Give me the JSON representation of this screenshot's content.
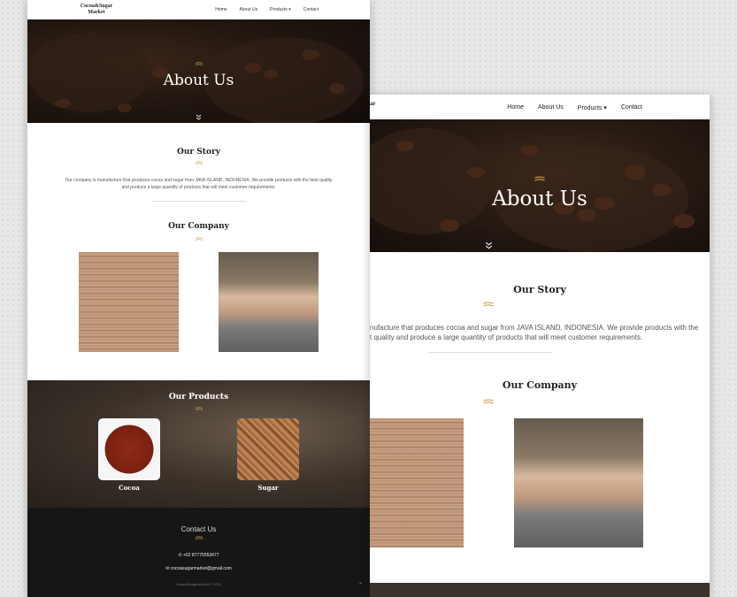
{
  "site": {
    "logo": "Cocoa&Sugar Market",
    "logo_partial": "ar",
    "nav": [
      {
        "label": "Home"
      },
      {
        "label": "About Us"
      },
      {
        "label": "Products ▾"
      },
      {
        "label": "Contact"
      }
    ]
  },
  "hero": {
    "title": "About Us"
  },
  "story": {
    "heading": "Our Story",
    "text": "Our company is manufacture that produces cocoa and sugar from JAVA ISLAND, INDONESIA. We provide products with the best quality and produce a large quantity of products that will meet customer requirements.",
    "text_cropped_line1": "nufacture that produces cocoa and sugar from JAVA ISLAND, INDONESIA. We provide products with the",
    "text_cropped_line2": "t quality and produce a large quantity of products that will meet customer requirements."
  },
  "company": {
    "heading": "Our Company"
  },
  "products": {
    "heading": "Our Products",
    "items": [
      {
        "label": "Cocoa"
      },
      {
        "label": "Sugar"
      }
    ]
  },
  "contact": {
    "heading": "Contact Us",
    "phone": "+62 87775553477",
    "email": "cocoasugarmarket@gmail.com",
    "copyright": "Cocoa&SugarMarket © 2021"
  },
  "colors": {
    "gold": "#c9a24a",
    "footer": "#161616"
  }
}
